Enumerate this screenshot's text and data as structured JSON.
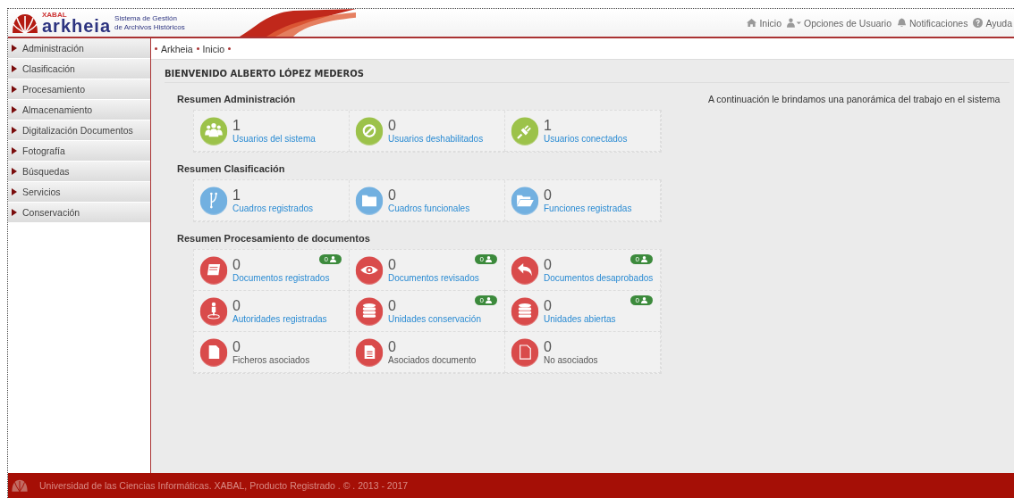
{
  "header": {
    "brand_small": "XABAL",
    "brand": "arkheia",
    "tagline": "Sistema de Gestión de Archivos Históricos",
    "nav": [
      {
        "label": "Inicio"
      },
      {
        "label": "Opciones de Usuario"
      },
      {
        "label": "Notificaciones"
      },
      {
        "label": "Ayuda"
      }
    ]
  },
  "sidebar": {
    "items": [
      {
        "label": "Administración"
      },
      {
        "label": "Clasificación"
      },
      {
        "label": "Procesamiento"
      },
      {
        "label": "Almacenamiento"
      },
      {
        "label": "Digitalización Documentos"
      },
      {
        "label": "Fotografía"
      },
      {
        "label": "Búsquedas"
      },
      {
        "label": "Servicios"
      },
      {
        "label": "Conservación"
      }
    ]
  },
  "breadcrumb": [
    "Arkheia",
    "Inicio"
  ],
  "welcome": "BIENVENIDO ALBERTO LÓPEZ MEDEROS",
  "intro": "A continuación le brindamos una panorámica del trabajo en el sistema",
  "sections": [
    {
      "title": "Resumen Administración",
      "color": "#9cc24a",
      "tiles": [
        {
          "count": "1",
          "label": "Usuarios del sistema",
          "link": true
        },
        {
          "count": "0",
          "label": "Usuarios deshabilitados",
          "link": true
        },
        {
          "count": "1",
          "label": "Usuarios conectados",
          "link": true
        }
      ]
    },
    {
      "title": "Resumen Clasificación",
      "color": "#72b0e0",
      "tiles": [
        {
          "count": "1",
          "label": "Cuadros registrados",
          "link": true
        },
        {
          "count": "0",
          "label": "Cuadros funcionales",
          "link": true
        },
        {
          "count": "0",
          "label": "Funciones registradas",
          "link": true
        }
      ]
    },
    {
      "title": "Resumen Procesamiento de documentos",
      "color": "#d94b4b",
      "tiles": [
        {
          "count": "0",
          "label": "Documentos registrados",
          "link": true,
          "badge": "0"
        },
        {
          "count": "0",
          "label": "Documentos revisados",
          "link": true,
          "badge": "0"
        },
        {
          "count": "0",
          "label": "Documentos desaprobados",
          "link": true,
          "badge": "0"
        },
        {
          "count": "0",
          "label": "Autoridades registradas",
          "link": true
        },
        {
          "count": "0",
          "label": "Unidades conservación",
          "link": true,
          "badge": "0"
        },
        {
          "count": "0",
          "label": "Unidades abiertas",
          "link": true,
          "badge": "0"
        },
        {
          "count": "0",
          "label": "Ficheros asociados",
          "link": false
        },
        {
          "count": "0",
          "label": "Asociados documento",
          "link": false
        },
        {
          "count": "0",
          "label": "No asociados",
          "link": false
        }
      ]
    }
  ],
  "footer": "Universidad de las Ciencias Informáticas. XABAL, Producto Registrado . © . 2013 - 2017"
}
